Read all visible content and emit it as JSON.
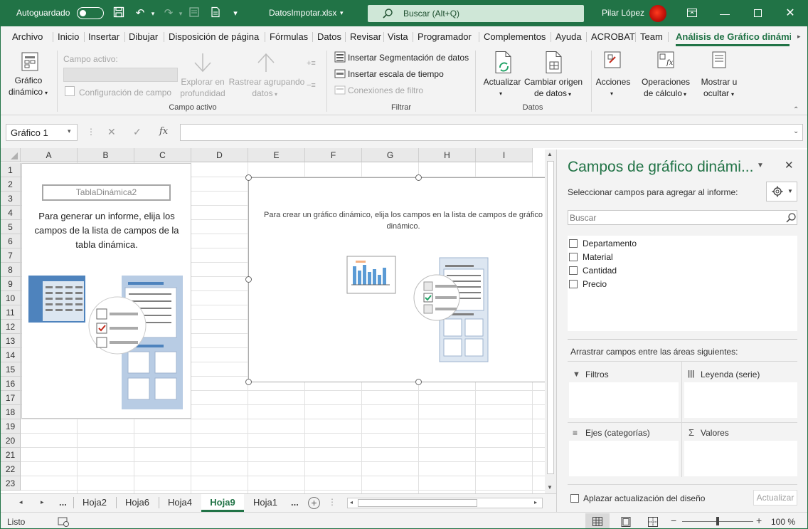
{
  "titlebar": {
    "autosave_label": "Autoguardado",
    "filename": "DatosImpotar.xlsx",
    "search_placeholder": "Buscar (Alt+Q)",
    "user_name": "Pilar López"
  },
  "tabs": [
    "Archivo",
    "Inicio",
    "Insertar",
    "Dibujar",
    "Disposición de página",
    "Fórmulas",
    "Datos",
    "Revisar",
    "Vista",
    "Programador",
    "Complementos",
    "Ayuda",
    "ACROBAT",
    "Team",
    "Análisis de Gráfico dinámico"
  ],
  "ribbon": {
    "chart_btn_l1": "Gráfico",
    "chart_btn_l2": "dinámico",
    "active_field_label": "Campo activo:",
    "field_config": "Configuración de campo",
    "drill_down_l1": "Explorar en",
    "drill_down_l2": "profundidad",
    "drill_up_l1": "Rastrear agrupando",
    "drill_up_l2": "datos",
    "group_active_field": "Campo activo",
    "insert_slicer": "Insertar Segmentación de datos",
    "insert_timeline": "Insertar escala de tiempo",
    "filter_connections": "Conexiones de filtro",
    "group_filter": "Filtrar",
    "refresh": "Actualizar",
    "change_source_l1": "Cambiar origen",
    "change_source_l2": "de datos",
    "group_data": "Datos",
    "actions": "Acciones",
    "calculations_l1": "Operaciones",
    "calculations_l2": "de cálculo",
    "show_hide_l1": "Mostrar u",
    "show_hide_l2": "ocultar"
  },
  "formula_bar": {
    "name_box": "Gráfico 1",
    "fx": "fx"
  },
  "grid": {
    "columns": [
      "A",
      "B",
      "C",
      "D",
      "E",
      "F",
      "G",
      "H",
      "I"
    ],
    "rows": [
      "1",
      "2",
      "3",
      "4",
      "5",
      "6",
      "7",
      "8",
      "9",
      "10",
      "11",
      "12",
      "13",
      "14",
      "15",
      "16",
      "17",
      "18",
      "19",
      "20",
      "21",
      "22",
      "23"
    ]
  },
  "pivot_placeholder": {
    "name": "TablaDinámica2",
    "message": "Para generar un informe, elija los campos de la lista de campos de la tabla dinámica."
  },
  "chart_placeholder": {
    "message": "Para crear un gráfico dinámico, elija los campos en la lista de campos de gráfico dinámico."
  },
  "sheet_tabs": [
    "Hoja2",
    "Hoja6",
    "Hoja4",
    "Hoja9",
    "Hoja1"
  ],
  "active_sheet": "Hoja9",
  "ellipsis": "...",
  "pane": {
    "title": "Campos de gráfico dinámi...",
    "subtitle": "Seleccionar campos para agregar al informe:",
    "search_placeholder": "Buscar",
    "fields": [
      "Departamento",
      "Material",
      "Cantidad",
      "Precio"
    ],
    "areas_label": "Arrastrar campos entre las áreas siguientes:",
    "area_filters": "Filtros",
    "area_legend": "Leyenda (serie)",
    "area_axis": "Ejes (categorías)",
    "area_values": "Valores",
    "defer_update": "Aplazar actualización del diseño",
    "update_btn": "Actualizar"
  },
  "status": {
    "ready": "Listo",
    "zoom": "100 %"
  },
  "colors": {
    "excel_green": "#217346",
    "ribbon_bg": "#f3f3f3"
  }
}
